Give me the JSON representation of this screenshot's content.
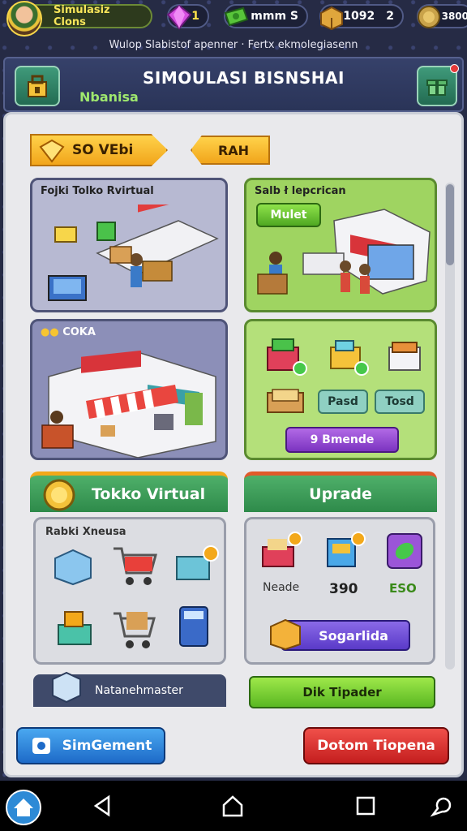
{
  "topbar": {
    "player_name": "Simulasiz Clons",
    "gems": "1",
    "cash": "mmm S",
    "crates": "1092",
    "crates_level": "2",
    "coins": "3800"
  },
  "subtitle": "Wulop Slabistof apenner · Fertx ekmolegiasenn",
  "header": {
    "title": "SIMOULASI BISNSHAI",
    "subtitle": "Nbanisa"
  },
  "tabs": {
    "active": "SO VEbi",
    "other": "RAH"
  },
  "cards": {
    "top_left": {
      "label": "Fojki Tolko Rvirtual"
    },
    "top_right": {
      "label": "Salb ł lepcrican",
      "button": "Mulet"
    },
    "mid_left": {
      "label": "COKA"
    },
    "mid_right": {
      "btn_a": "Pasd",
      "btn_b": "Tosd",
      "cta": "9 Bmende"
    }
  },
  "toko": {
    "title": "Tokko Virtual",
    "sub_label": "Rabki Xneusa",
    "footer": "Natanehmaster"
  },
  "upgrade": {
    "title": "Uprade",
    "item_label": "Neade",
    "item_price": "390",
    "item_price2": "ESO",
    "cta": "Sogarlida",
    "buy": "Dik Tipader"
  },
  "bottom": {
    "left": "SimGement",
    "right": "Dotom Tiopena"
  },
  "colors": {
    "green_section": "#3e9a5a",
    "red_accent": "#e53a3a",
    "gold": "#f7c531",
    "blue_button": "#2d8ad6",
    "purple_button": "#9b55d8",
    "lime_button": "#7fd23a"
  }
}
